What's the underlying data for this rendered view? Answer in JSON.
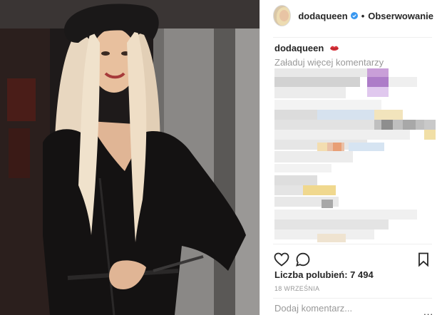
{
  "header": {
    "username": "dodaqueen",
    "separator": "•",
    "follow_label": "Obserwowanie",
    "verified_icon": "verified-badge-icon",
    "accent": "#3897f0"
  },
  "caption": {
    "username": "dodaqueen",
    "emoji_icon": "lips-icon"
  },
  "comments": {
    "load_more_label": "Załaduj więcej komentarzy"
  },
  "actions": {
    "like_icon": "heart-icon",
    "comment_icon": "comment-icon",
    "save_icon": "bookmark-icon"
  },
  "likes": {
    "label": "Liczba polubień: 7 494"
  },
  "date": {
    "label": "18 WRZEŚNIA"
  },
  "add_comment": {
    "placeholder": "Dodaj komentarz..."
  },
  "more_label": "..."
}
